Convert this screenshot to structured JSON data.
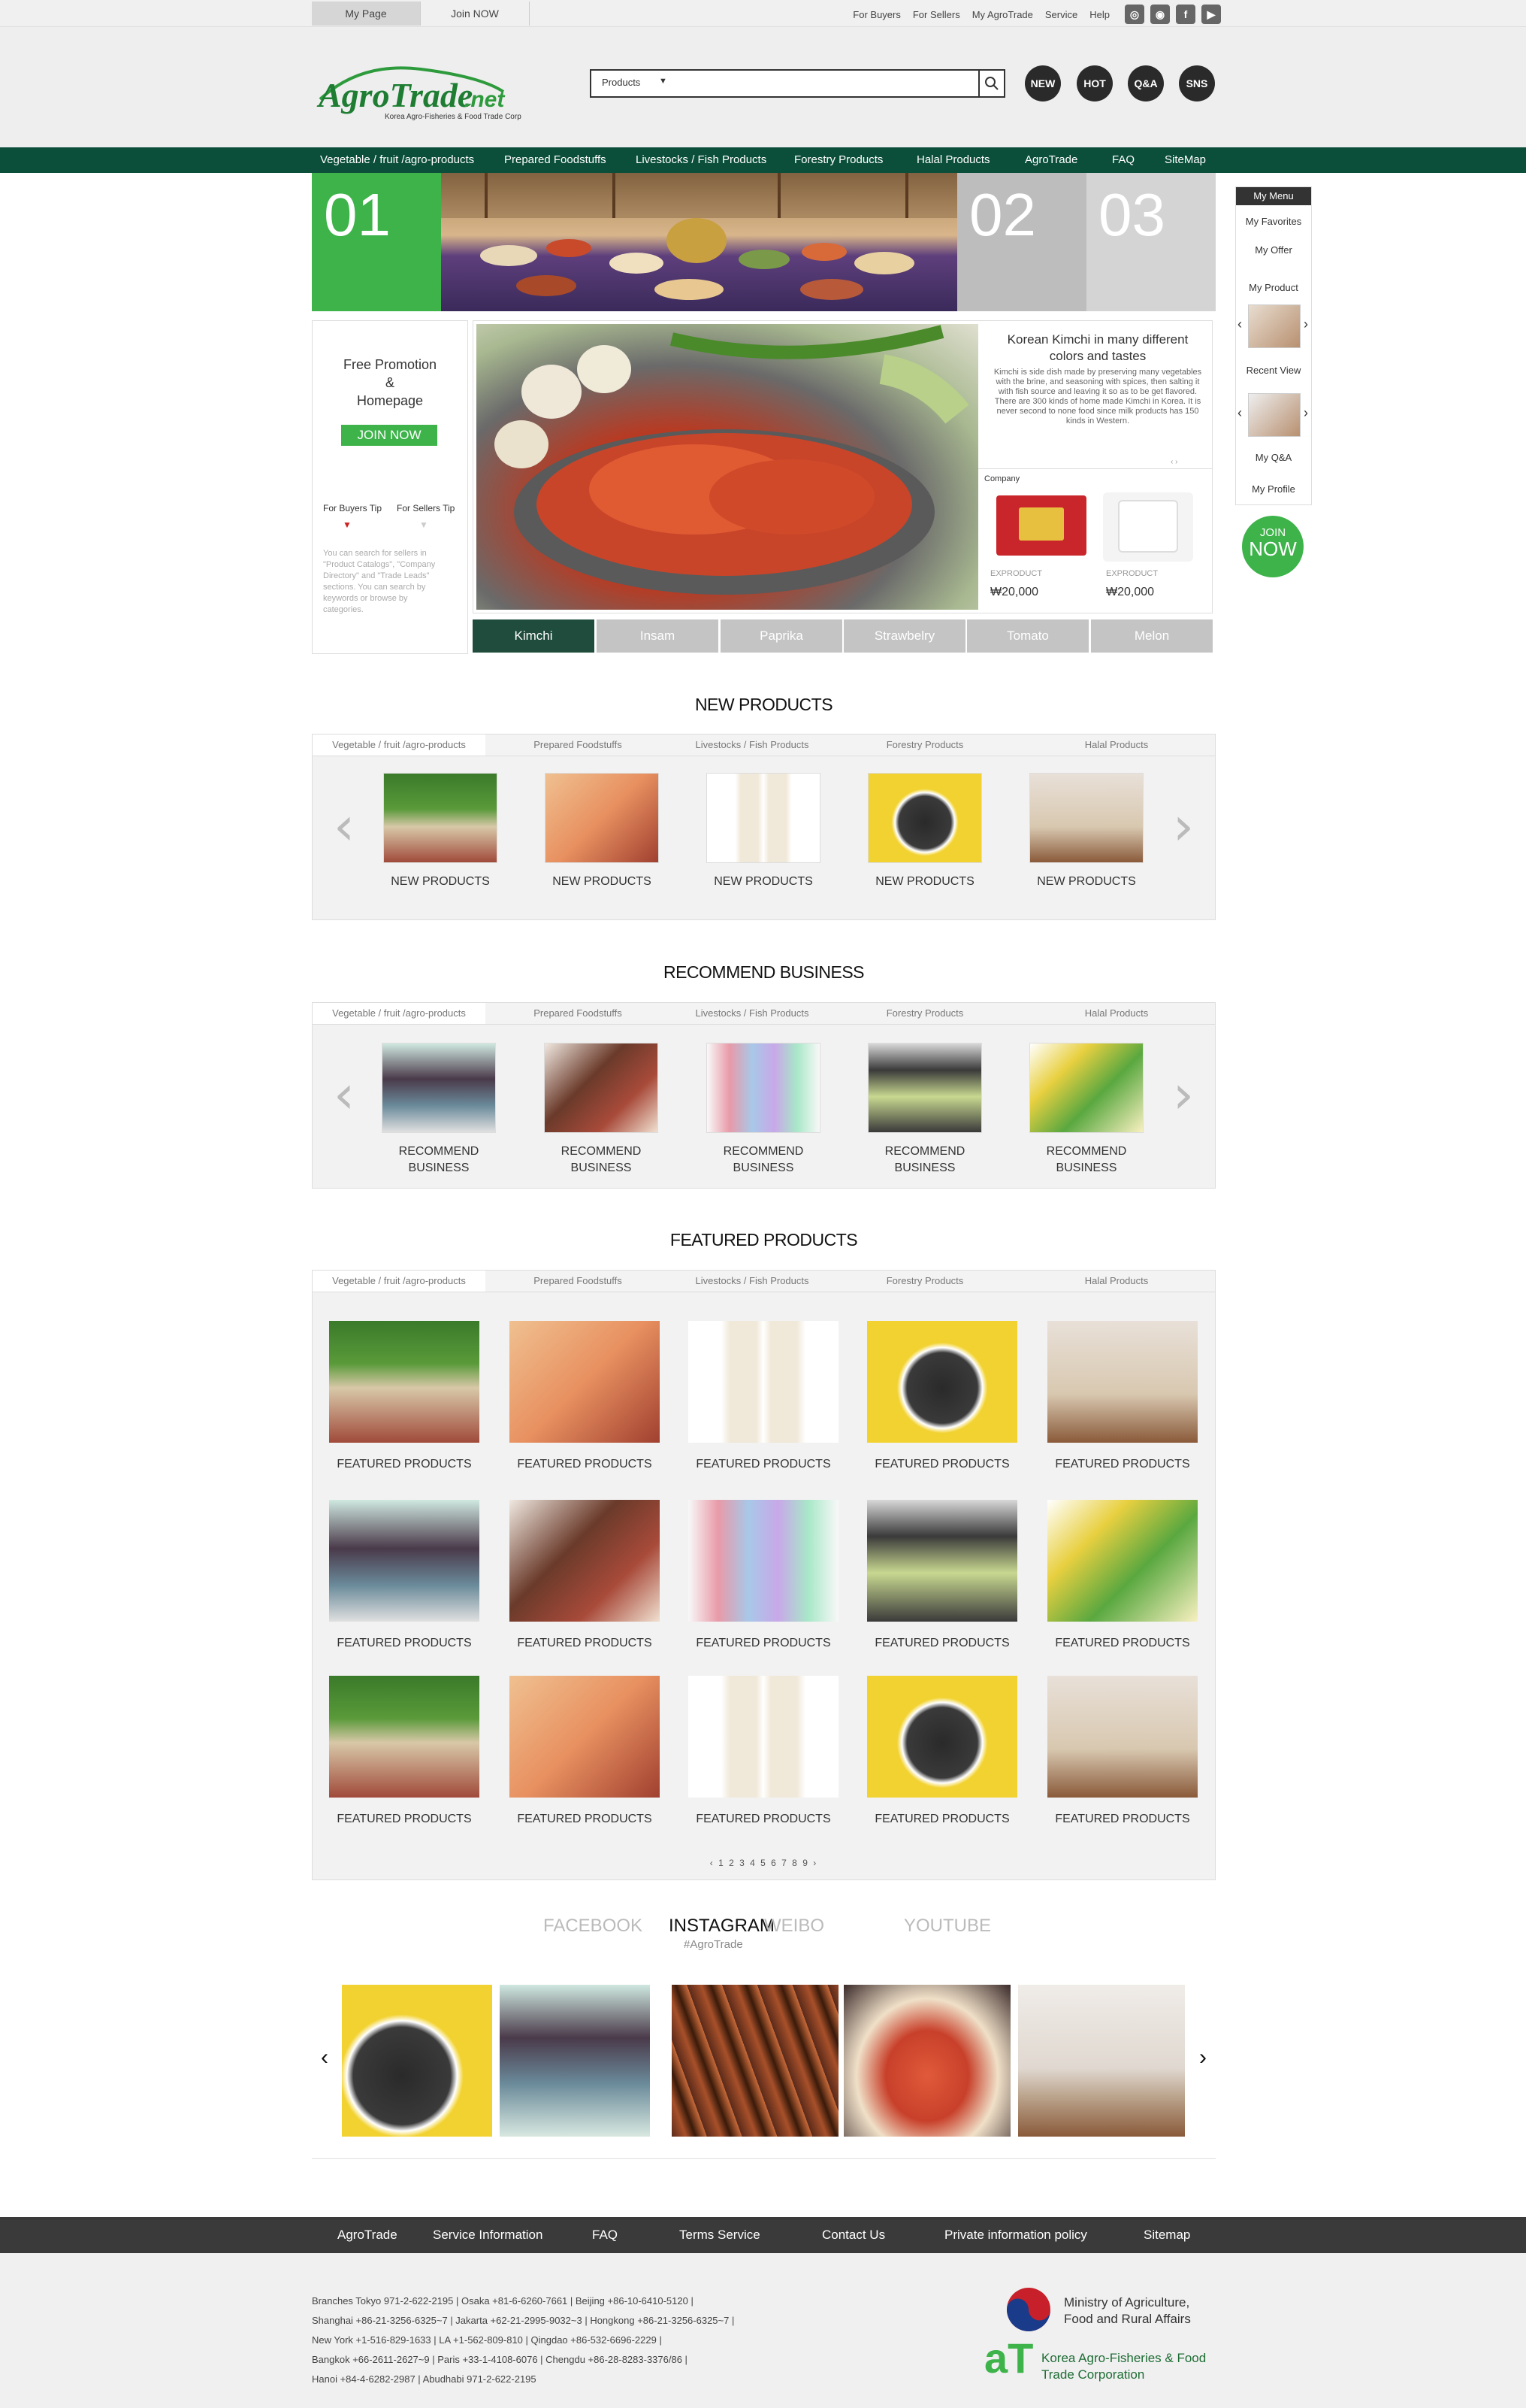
{
  "topbar": {
    "tab_mypage": "My Page",
    "tab_join": "Join NOW",
    "links": [
      "For Buyers",
      "For Sellers",
      "My AgroTrade",
      "Service",
      "Help"
    ],
    "sns_icons": [
      "instagram-icon",
      "weibo-icon",
      "facebook-icon",
      "youtube-icon"
    ]
  },
  "header": {
    "logo_main": "AgroTrade.net",
    "logo_sub": "Korea Agro-Fisheries & Food Trade Corp",
    "search_category": "Products",
    "buttons": [
      "NEW",
      "HOT",
      "Q&A",
      "SNS"
    ]
  },
  "nav": {
    "items": [
      "Vegetable / fruit /agro-products",
      "Prepared Foodstuffs",
      "Livestocks / Fish Products",
      "Forestry Products",
      "Halal Products",
      "AgroTrade",
      "FAQ",
      "SiteMap"
    ]
  },
  "banner": {
    "slides": [
      "01",
      "02",
      "03"
    ]
  },
  "mymenu": {
    "title": "My Menu",
    "items": [
      "My Favorites",
      "My Offer",
      "My Product",
      "Recent View",
      "My Q&A",
      "My Profile"
    ],
    "join1": "JOIN",
    "join2": "NOW"
  },
  "promo": {
    "line1": "Free Promotion",
    "line2": "&",
    "line3": "Homepage",
    "join": "JOIN NOW",
    "tab_buyers": "For Buyers Tip",
    "tab_sellers": "For Sellers Tip",
    "tip": "You can search for sellers in \"Product Catalogs\", \"Company Directory\" and \"Trade Leads\" sections. You can search by keywords or browse by categories."
  },
  "kimchi": {
    "title": "Korean Kimchi in many different colors and tastes",
    "desc": "Kimchi is side dish made by preserving many vegetables with the brine, and seasoning with spices, then salting it with fish source and leaving it so as to be get flavored. There are 300 kinds of home made Kimchi in Korea. It is never second to none food since milk products has 150 kinds in Western.",
    "company": "Company",
    "p1_label": "EXPRODUCT",
    "p1_price": "₩20,000",
    "p2_label": "EXPRODUCT",
    "p2_price": "₩20,000",
    "tabs": [
      "Kimchi",
      "Insam",
      "Paprika",
      "Strawbelry",
      "Tomato",
      "Melon"
    ]
  },
  "categories": [
    "Vegetable / fruit /agro-products",
    "Prepared Foodstuffs",
    "Livestocks / Fish Products",
    "Forestry Products",
    "Halal Products"
  ],
  "new_products": {
    "title": "NEW PRODUCTS",
    "label": "NEW PRODUCTS"
  },
  "recommend": {
    "title": "RECOMMEND BUSINESS",
    "label1": "RECOMMEND",
    "label2": "BUSINESS"
  },
  "featured": {
    "title": "FEATURED PRODUCTS",
    "label": "FEATURED PRODUCTS",
    "pagination": "‹  1 2 3 4 5 6 7 8 9  ›"
  },
  "social": {
    "tabs": [
      "FACEBOOK",
      "INSTAGRAM",
      "WEIBO",
      "YOUTUBE"
    ],
    "hashtag": "#AgroTrade"
  },
  "footnav": {
    "items": [
      "AgroTrade",
      "Service Information",
      "FAQ",
      "Terms Service",
      "Contact Us",
      "Private information policy",
      "Sitemap"
    ]
  },
  "footer": {
    "lines": [
      "Branches Tokyo 971-2-622-2195  |  Osaka +81-6-6260-7661  |  Beijing +86-10-6410-5120  |",
      "Shanghai +86-21-3256-6325~7  |  Jakarta +62-21-2995-9032~3  |  Hongkong +86-21-3256-6325~7  |",
      "New York +1-516-829-1633  |  LA +1-562-809-810  |  Qingdao +86-532-6696-2229  |",
      "Bangkok +66-2611-2627~9  |  Paris +33-1-4108-6076  |  Chengdu +86-28-8283-3376/86  |",
      "Hanoi +84-4-6282-2987  |  Abudhabi 971-2-622-2195"
    ],
    "ministry1": "Ministry of Agriculture,",
    "ministry2": "Food and Rural Affairs",
    "at_logo": "aT",
    "at1": "Korea Agro-Fisheries & Food",
    "at2": "Trade Corporation"
  }
}
